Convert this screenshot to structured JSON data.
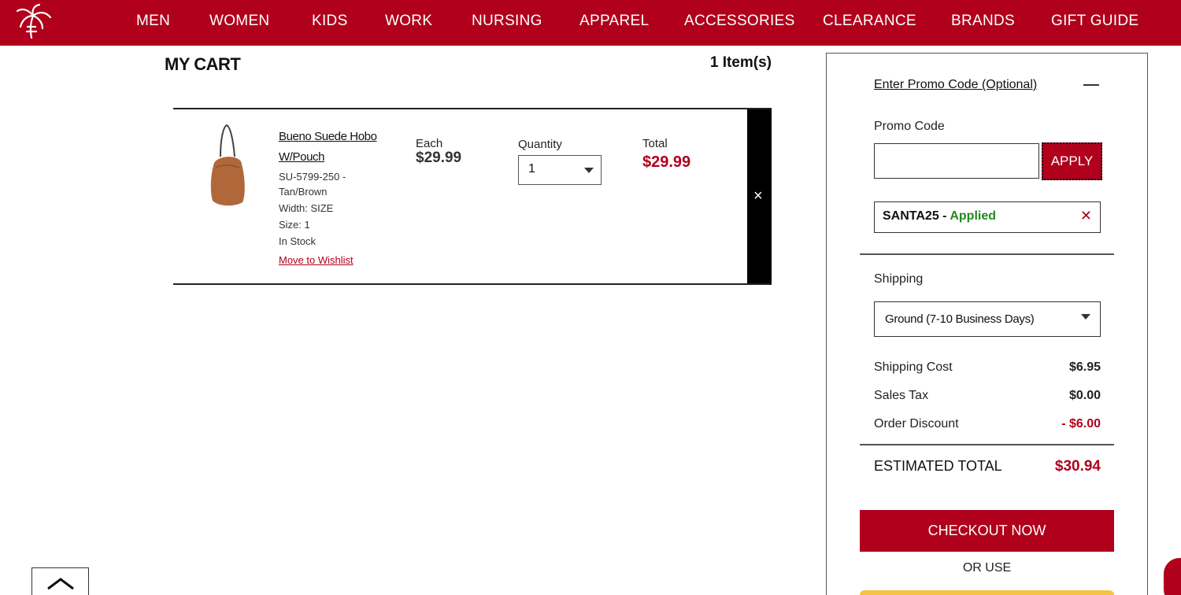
{
  "nav": {
    "logo_name": "palm-tree-logo",
    "items": [
      "MEN",
      "WOMEN",
      "KIDS",
      "WORK",
      "NURSING",
      "APPAREL",
      "ACCESSORIES",
      "CLEARANCE",
      "BRANDS",
      "GIFT GUIDE"
    ]
  },
  "cart": {
    "title": "MY CART",
    "item_count": "1 Item(s)",
    "items": [
      {
        "name": "Bueno Suede Hobo W/Pouch",
        "sku": "SU-5799-250 - Tan/Brown",
        "width": "Width: SIZE",
        "size": "Size: 1",
        "stock": "In Stock",
        "wishlist_label": "Move to Wishlist",
        "each_label": "Each",
        "each_price": "$29.99",
        "quantity_label": "Quantity",
        "quantity": "1",
        "total_label": "Total",
        "total": "$29.99",
        "remove_icon": "×"
      }
    ]
  },
  "summary": {
    "promo_toggle": "Enter Promo Code (Optional)",
    "promo_label": "Promo Code",
    "promo_value": "",
    "apply_label": "APPLY",
    "applied_code": "SANTA25",
    "applied_separator": " - ",
    "applied_status": "Applied",
    "remove_icon": "✕",
    "shipping_label": "Shipping",
    "shipping_option": "Ground (7-10 Business Days)",
    "rows": [
      {
        "label": "Shipping Cost",
        "value": "$6.95"
      },
      {
        "label": "Sales Tax",
        "value": "$0.00"
      },
      {
        "label": "Order Discount",
        "value": "- $6.00"
      }
    ],
    "estimated_label": "ESTIMATED TOTAL",
    "estimated_total": "$30.94",
    "checkout_label": "CHECKOUT NOW",
    "or_use": "OR USE"
  },
  "colors": {
    "brand_red": "#b0001c",
    "applied_green": "#218a1f",
    "paypal_yellow": "#f6c244"
  }
}
